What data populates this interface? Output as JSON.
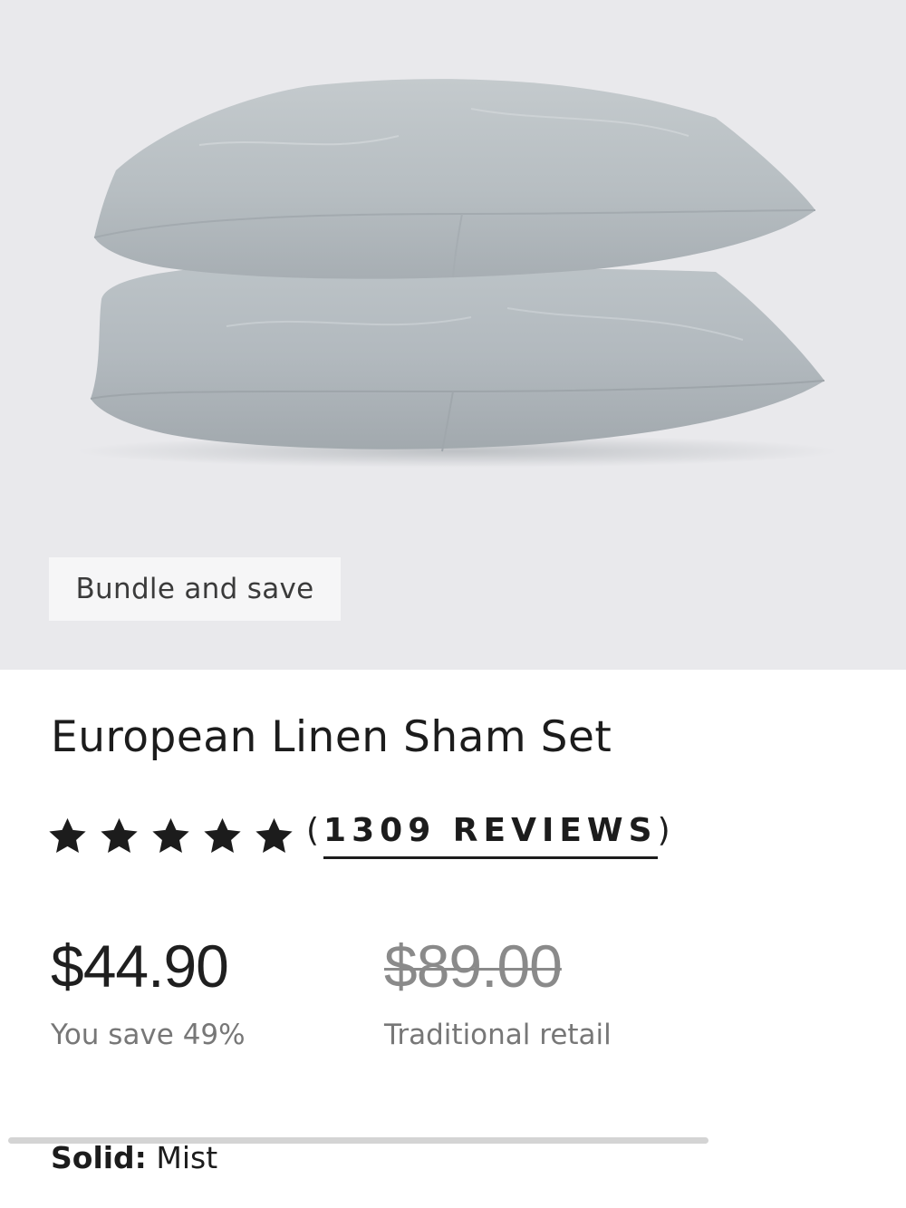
{
  "hero": {
    "badge": "Bundle and save",
    "background": "#e9e9ec",
    "pillow_color": "#b8bfc4"
  },
  "product": {
    "title": "European Linen Sham Set",
    "rating_stars": 5,
    "reviews_open": "(",
    "reviews_link": "1309 REVIEWS",
    "reviews_close": ")",
    "price": "$44.90",
    "savings": "You save 49%",
    "retail_price": "$89.00",
    "retail_label": "Traditional retail"
  },
  "variant": {
    "label": "Solid:",
    "value": "Mist"
  }
}
